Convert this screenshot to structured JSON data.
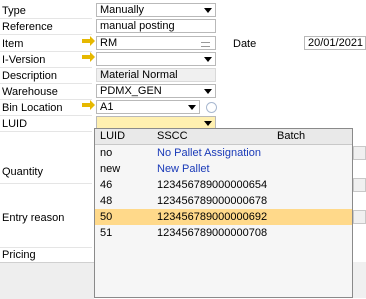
{
  "form": {
    "type": {
      "label": "Type",
      "value": "Manually"
    },
    "reference": {
      "label": "Reference",
      "value": "manual posting"
    },
    "item": {
      "label": "Item",
      "value": "RM"
    },
    "date": {
      "label": "Date",
      "value": "20/01/2021"
    },
    "iversion": {
      "label": "I-Version",
      "value": ""
    },
    "description": {
      "label": "Description",
      "value": "Material Normal"
    },
    "warehouse": {
      "label": "Warehouse",
      "value": "PDMX_GEN"
    },
    "bin_location": {
      "label": "Bin Location",
      "value": "A1"
    },
    "luid": {
      "label": "LUID",
      "value": ""
    },
    "quantity": {
      "label": "Quantity"
    },
    "entry_reason": {
      "label": "Entry reason"
    },
    "pricing": {
      "label": "Pricing"
    }
  },
  "luid_dropdown": {
    "headers": [
      "LUID",
      "SSCC",
      "Batch"
    ],
    "rows": [
      {
        "luid": "no",
        "sscc": "No Pallet Assignation",
        "batch": ""
      },
      {
        "luid": "new",
        "sscc": "New Pallet",
        "batch": ""
      },
      {
        "luid": "46",
        "sscc": "123456789000000654",
        "batch": ""
      },
      {
        "luid": "48",
        "sscc": "123456789000000678",
        "batch": ""
      },
      {
        "luid": "50",
        "sscc": "123456789000000692",
        "batch": ""
      },
      {
        "luid": "51",
        "sscc": "123456789000000708",
        "batch": ""
      }
    ],
    "selected_index": 4
  },
  "colors": {
    "selected_row": "#ffd98a",
    "link_blue": "#1a3ab8",
    "highlight_field": "#fff0b0",
    "arrow": "#e6b800"
  }
}
